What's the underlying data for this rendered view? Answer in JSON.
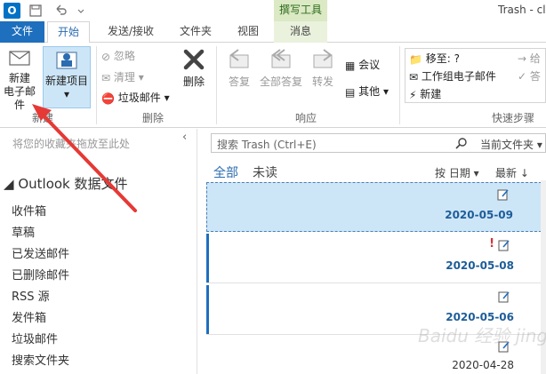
{
  "titlebar": {
    "app_icon_letter": "O",
    "context_tab": "撰写工具",
    "window_title": "Trash - cl"
  },
  "tabs": [
    "文件",
    "开始",
    "发送/接收",
    "文件夹",
    "视图",
    "消息"
  ],
  "ribbon": {
    "new_email_line1": "新建",
    "new_email_line2": "电子邮件",
    "new_items": "新建项目",
    "group_new": "新建",
    "ignore": "忽略",
    "clean_up": "清理",
    "junk": "垃圾邮件",
    "delete": "删除",
    "group_delete": "删除",
    "reply": "答复",
    "reply_all": "全部答复",
    "forward": "转发",
    "meeting": "会议",
    "more": "其他",
    "group_respond": "响应",
    "quick_move": "移至: ?",
    "quick_team": "工作组电子邮件",
    "quick_new": "新建",
    "quick_r1": "给",
    "quick_r2": "答",
    "group_quicksteps": "快速步骤"
  },
  "navpane": {
    "favorites_hint": "将您的收藏夹拖放至此处",
    "section": "Outlook 数据文件",
    "folders": [
      "收件箱",
      "草稿",
      "已发送邮件",
      "已删除邮件",
      "RSS 源",
      "发件箱",
      "垃圾邮件",
      "搜索文件夹"
    ]
  },
  "list": {
    "search_placeholder": "搜索 Trash (Ctrl+E)",
    "scope": "当前文件夹",
    "filter_all": "全部",
    "filter_unread": "未读",
    "sort_by": "按 日期",
    "order": "最新 ↓",
    "messages": [
      {
        "date": "2020-05-09"
      },
      {
        "date": "2020-05-08"
      },
      {
        "date": "2020-05-06"
      },
      {
        "date": "2020-04-28"
      }
    ]
  },
  "watermark": "Baidu 经验 jingyan.baidu.com",
  "colors": {
    "accent": "#1e6fbd",
    "selected_row": "#cde6f7",
    "context_tab": "#dbe9c5",
    "annotation_arrow": "#e53935"
  }
}
